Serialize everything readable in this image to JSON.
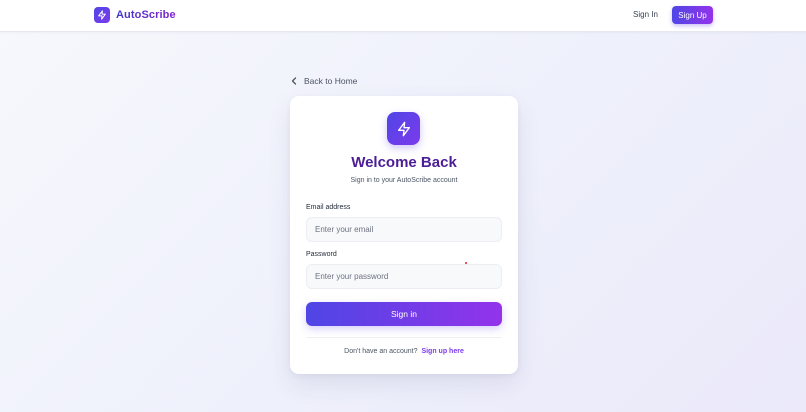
{
  "header": {
    "brand_name": "AutoScribe",
    "brand_icon": "lightning-bolt-icon",
    "signin_label": "Sign In",
    "signup_label": "Sign Up"
  },
  "back_link": {
    "icon": "chevron-left-icon",
    "label": "Back to Home"
  },
  "card": {
    "logo_icon": "lightning-bolt-icon",
    "title": "Welcome Back",
    "subtitle": "Sign in to your AutoScribe account",
    "email": {
      "label": "Email address",
      "placeholder": "Enter your email",
      "value": ""
    },
    "password": {
      "label": "Password",
      "placeholder": "Enter your password",
      "value": ""
    },
    "submit_label": "Sign in",
    "signup_prompt": "Don't have an account?",
    "signup_link": "Sign up here"
  },
  "colors": {
    "accent_start": "#4f46e5",
    "accent_end": "#9333ea",
    "title": "#4c1d95",
    "link": "#7c3aed"
  }
}
